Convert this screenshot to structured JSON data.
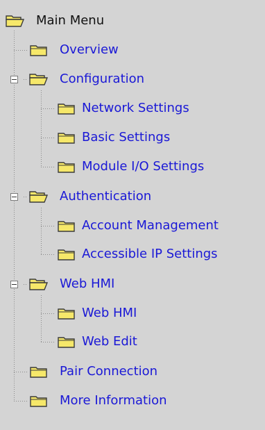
{
  "menu": {
    "root": {
      "label": "Main Menu",
      "icon": "folder-open-icon"
    },
    "overview": {
      "label": "Overview",
      "icon": "folder-icon"
    },
    "configuration": {
      "label": "Configuration",
      "icon": "folder-open-icon",
      "expanded": true,
      "children": [
        {
          "label": "Network Settings",
          "icon": "folder-icon"
        },
        {
          "label": "Basic Settings",
          "icon": "folder-icon"
        },
        {
          "label": "Module I/O Settings",
          "icon": "folder-icon"
        }
      ]
    },
    "authentication": {
      "label": "Authentication",
      "icon": "folder-open-icon",
      "expanded": true,
      "children": [
        {
          "label": "Account Management",
          "icon": "folder-icon"
        },
        {
          "label": "Accessible IP Settings",
          "icon": "folder-icon"
        }
      ]
    },
    "web_hmi": {
      "label": "Web HMI",
      "icon": "folder-open-icon",
      "expanded": true,
      "children": [
        {
          "label": "Web HMI",
          "icon": "folder-icon"
        },
        {
          "label": "Web Edit",
          "icon": "folder-icon"
        }
      ]
    },
    "pair_connection": {
      "label": "Pair Connection",
      "icon": "folder-icon"
    },
    "more_information": {
      "label": "More Information",
      "icon": "folder-icon"
    }
  },
  "colors": {
    "background": "#d4d4d4",
    "link": "#1a18d6",
    "folder_fill": "#f6e86a",
    "folder_outline": "#3a3a3a"
  }
}
